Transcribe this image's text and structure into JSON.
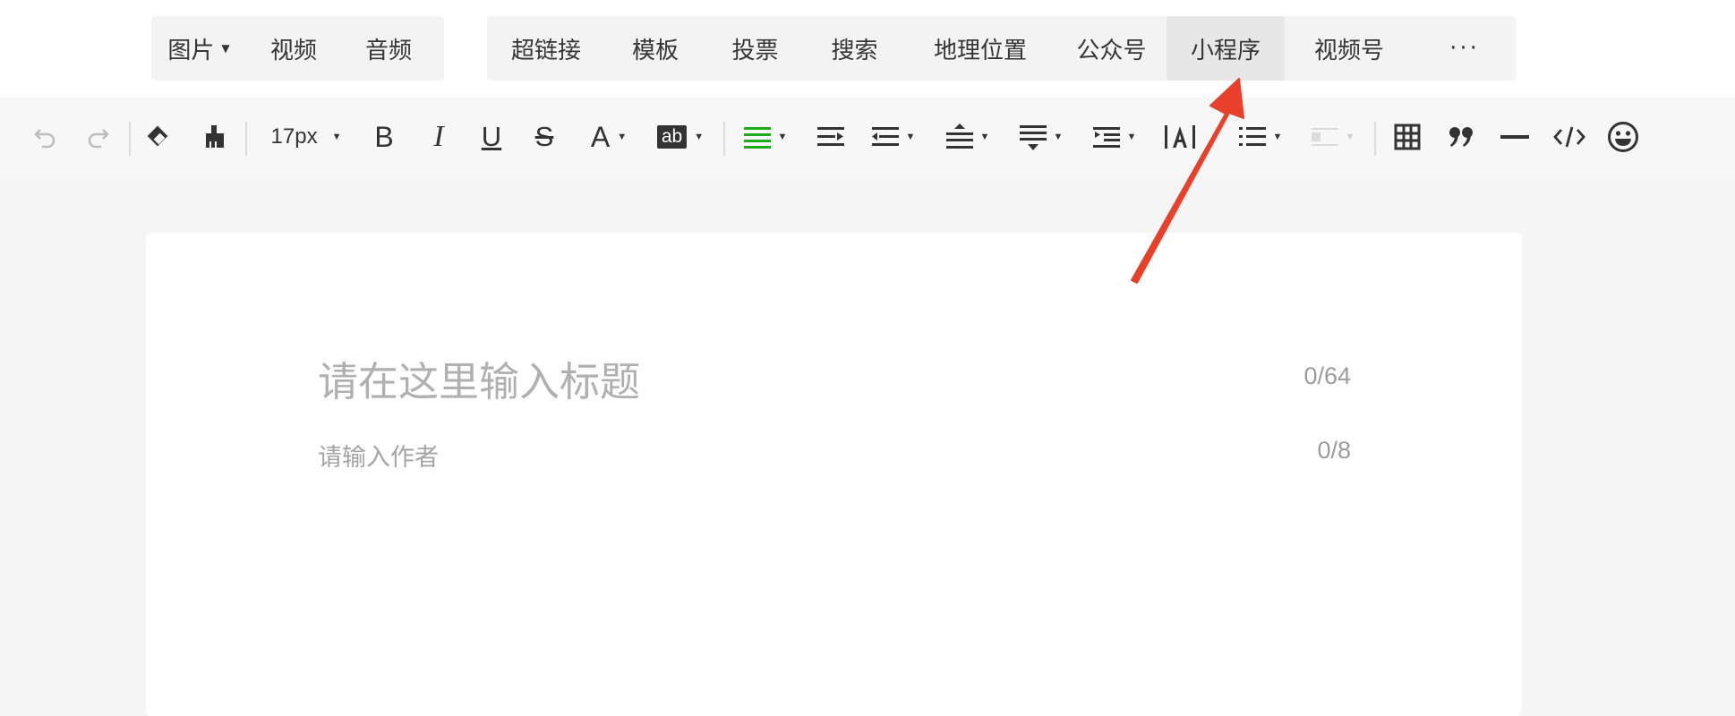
{
  "insert_menu": {
    "media": [
      {
        "label": "图片",
        "has_dropdown": true
      },
      {
        "label": "视频",
        "has_dropdown": false
      },
      {
        "label": "音频",
        "has_dropdown": false
      }
    ],
    "content": [
      {
        "label": "超链接"
      },
      {
        "label": "模板"
      },
      {
        "label": "投票"
      },
      {
        "label": "搜索"
      },
      {
        "label": "地理位置"
      },
      {
        "label": "公众号"
      },
      {
        "label": "小程序",
        "active": true
      },
      {
        "label": "视频号"
      }
    ],
    "more_label": "···"
  },
  "toolbar": {
    "font_size": "17px",
    "bold": "B",
    "italic": "I",
    "underline": "U",
    "strike": "S",
    "font_color": "A",
    "highlight": "ab",
    "icons": [
      "undo-icon",
      "redo-icon",
      "eraser-icon",
      "format-painter-icon",
      "align-left-icon",
      "indent-right-icon",
      "align-center-icon",
      "line-height-icon",
      "paragraph-spacing-icon",
      "indent-icon",
      "letter-spacing-icon",
      "list-icon",
      "image-align-icon",
      "table-icon",
      "quote-icon",
      "divider-icon",
      "code-icon",
      "emoji-icon"
    ],
    "accent_color": "#1aad19"
  },
  "editor": {
    "title_placeholder": "请在这里输入标题",
    "title_count": "0/64",
    "author_placeholder": "请输入作者",
    "author_count": "0/8"
  },
  "annotation": {
    "color": "#e8402a",
    "target": "小程序"
  }
}
